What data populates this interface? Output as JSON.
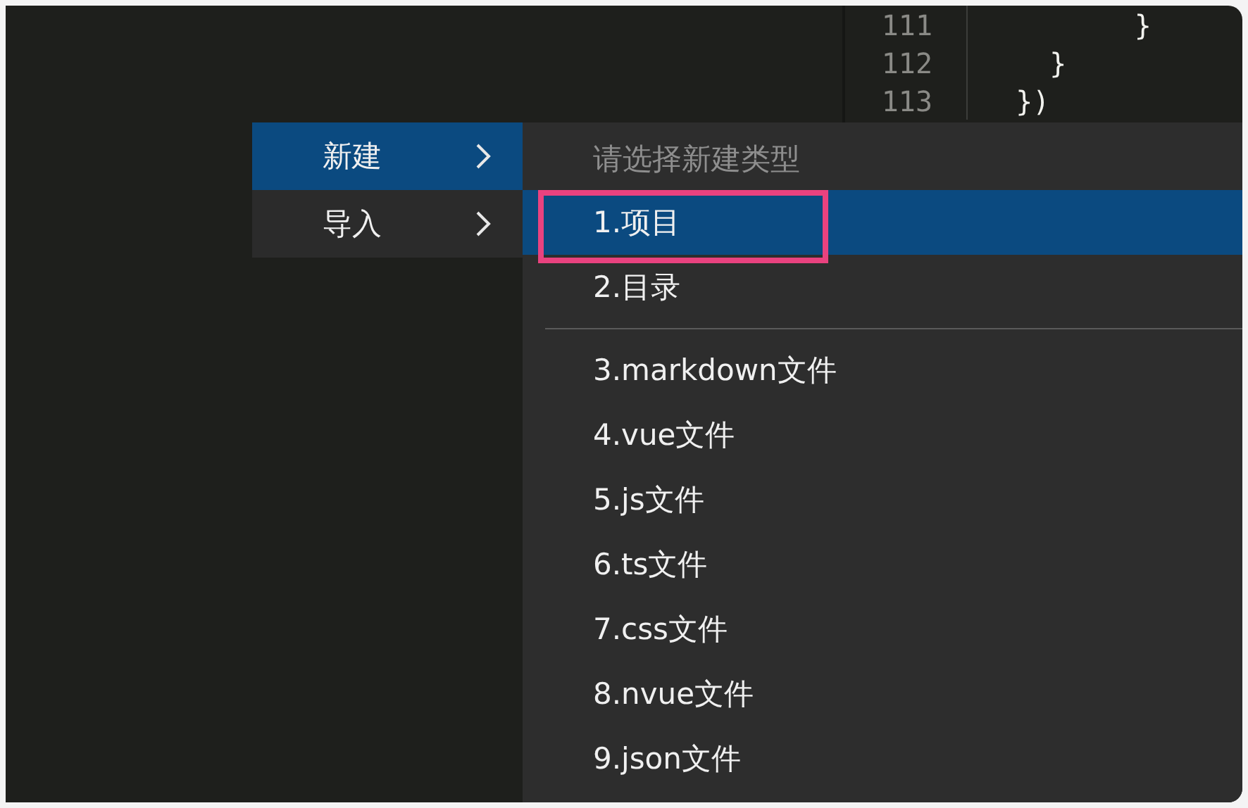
{
  "editor": {
    "lines": [
      {
        "number": "111",
        "code": "         }"
      },
      {
        "number": "112",
        "code": "    }"
      },
      {
        "number": "113",
        "code": "  })"
      }
    ]
  },
  "context_menu": {
    "items": [
      {
        "label": "新建",
        "selected": true,
        "has_submenu": true
      },
      {
        "label": "导入",
        "selected": false,
        "has_submenu": true
      }
    ]
  },
  "submenu": {
    "title": "请选择新建类型",
    "items": [
      {
        "kind": "item",
        "label": "1.项目",
        "selected": true,
        "annotated": true
      },
      {
        "kind": "item",
        "label": "2.目录",
        "selected": false,
        "annotated": false
      },
      {
        "kind": "separator"
      },
      {
        "kind": "item",
        "label": "3.markdown文件",
        "selected": false,
        "annotated": false
      },
      {
        "kind": "item",
        "label": "4.vue文件",
        "selected": false,
        "annotated": false
      },
      {
        "kind": "item",
        "label": "5.js文件",
        "selected": false,
        "annotated": false
      },
      {
        "kind": "item",
        "label": "6.ts文件",
        "selected": false,
        "annotated": false
      },
      {
        "kind": "item",
        "label": "7.css文件",
        "selected": false,
        "annotated": false
      },
      {
        "kind": "item",
        "label": "8.nvue文件",
        "selected": false,
        "annotated": false
      },
      {
        "kind": "item",
        "label": "9.json文件",
        "selected": false,
        "annotated": false
      }
    ]
  }
}
